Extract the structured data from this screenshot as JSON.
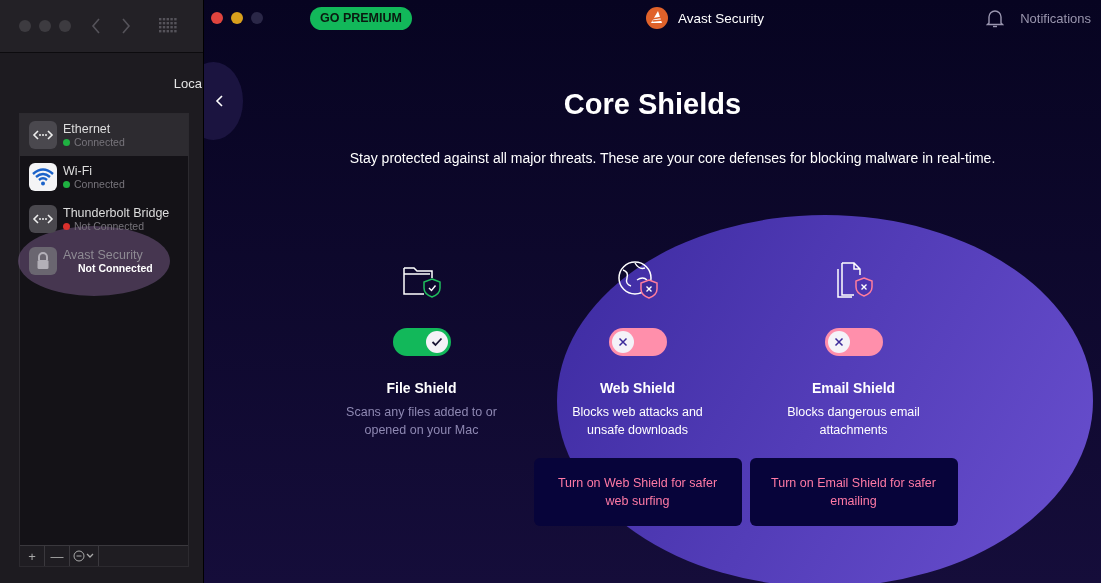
{
  "network_window": {
    "location_label": "Loca",
    "services": [
      {
        "name": "Ethernet",
        "status": "Connected",
        "color": "#1fb141",
        "kind": "ethernet",
        "selected": true,
        "highlighted": false
      },
      {
        "name": "Wi-Fi",
        "status": "Connected",
        "color": "#1fb141",
        "kind": "wifi",
        "selected": false,
        "highlighted": false
      },
      {
        "name": "Thunderbolt Bridge",
        "status": "Not Connected",
        "color": "#d9302c",
        "kind": "ethernet",
        "selected": false,
        "highlighted": false
      },
      {
        "name": "Avast Security",
        "status": "Not Connected",
        "kind": "vpn",
        "selected": false,
        "highlighted": true
      }
    ],
    "toolbar": [
      "+",
      "—"
    ]
  },
  "app": {
    "premium_button": "GO PREMIUM",
    "title": "Avast Security",
    "notifications": "Notifications",
    "heading": "Core Shields",
    "subtitle": "Stay protected against all major threats. These are your core defenses for blocking malware in real-time.",
    "shields": [
      {
        "on": true,
        "name": "File Shield",
        "description": "Scans any files added to or opened on your Mac"
      },
      {
        "on": false,
        "name": "Web Shield",
        "description": "Blocks web attacks and unsafe downloads",
        "tip": "Turn on Web Shield for safer web surfing"
      },
      {
        "on": false,
        "name": "Email Shield",
        "description": "Blocks dangerous email attachments",
        "tip": "Turn on Email Shield for safer emailing"
      }
    ]
  }
}
